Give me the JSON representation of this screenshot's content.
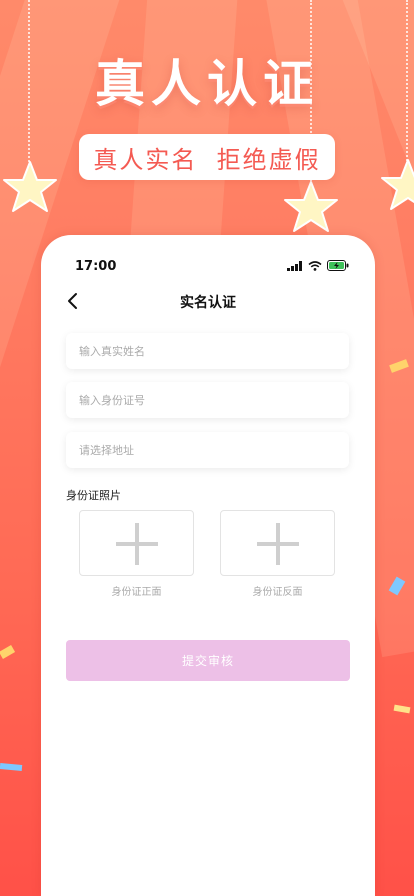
{
  "banner": {
    "headline": "真人认证",
    "slogan": "真人实名  拒绝虚假"
  },
  "status_bar": {
    "time": "17:00"
  },
  "nav": {
    "title": "实名认证"
  },
  "form": {
    "name_placeholder": "输入真实姓名",
    "id_placeholder": "输入身份证号",
    "address_placeholder": "请选择地址",
    "photo_section_label": "身份证照片",
    "front_caption": "身份证正面",
    "back_caption": "身份证反面",
    "submit_label": "提交审核"
  },
  "colors": {
    "background_top": "#ff8a6a",
    "background_bottom": "#ff5148",
    "slogan_text": "#f45a52",
    "submit_disabled": "#edc0e7",
    "battery_charging": "#3ec15a"
  }
}
